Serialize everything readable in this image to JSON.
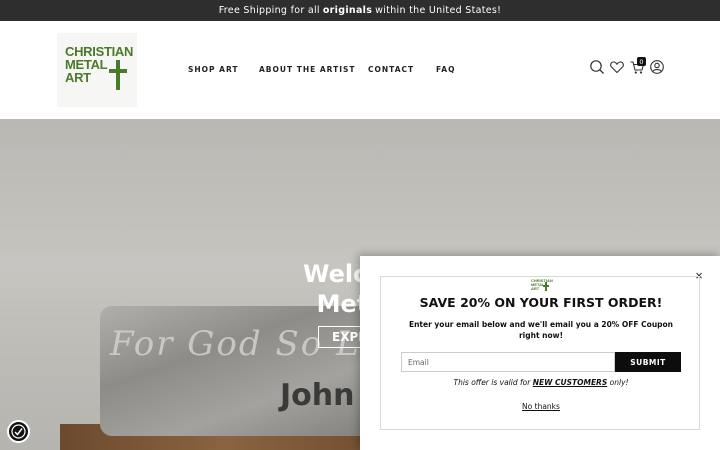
{
  "announcement": {
    "prefix": "Free Shipping for all",
    "bold": "originals",
    "suffix": "within the United States!"
  },
  "logo": {
    "line1": "CHRISTIAN",
    "line2": "METAL",
    "line3": "ART"
  },
  "nav": {
    "items": [
      "SHOP ART",
      "ABOUT THE ARTIST",
      "CONTACT",
      "FAQ"
    ]
  },
  "header_icons": {
    "search": "search-icon",
    "wishlist": "heart-icon",
    "cart": "cart-icon",
    "account": "user-icon",
    "cart_count": "0"
  },
  "hero": {
    "title_line1": "Welcome t",
    "title_line2": "Metal Ar",
    "button_label": "EXPL",
    "sign_script": "For God So Lo",
    "sign_name": "John"
  },
  "popup": {
    "close": "×",
    "title": "SAVE 20% ON YOUR FIRST ORDER!",
    "description": "Enter your email below and we'll email you a 20% OFF Coupon right now!",
    "email_placeholder": "Email",
    "submit_label": "SUBMIT",
    "valid_prefix": "This offer is valid for",
    "valid_emphasis": "NEW CUSTOMERS",
    "valid_suffix": "only!",
    "no_thanks": "No thanks"
  },
  "colors": {
    "brand_green": "#4a7a2c",
    "announcement_bg": "#2e2e2e",
    "button_black": "#0d0d0d"
  }
}
